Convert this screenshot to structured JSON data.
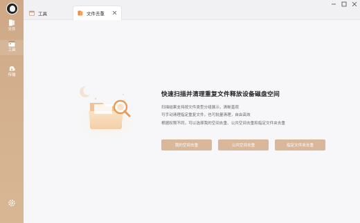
{
  "sidebar": {
    "items": [
      {
        "label": "文件",
        "icon": "file-icon"
      },
      {
        "label": "工具",
        "icon": "toolbox-icon"
      },
      {
        "label": "传输",
        "icon": "transfer-icon"
      }
    ],
    "settings_icon": "gear-icon"
  },
  "tabs": [
    {
      "label": "工具",
      "icon": "toolbox-tab-icon"
    },
    {
      "label": "文件去重",
      "icon": "dedupe-tab-icon"
    }
  ],
  "main": {
    "title": "快速扫描并清理重复文件释放设备磁盘空间",
    "description": [
      "扫描结果支持按文件类型分组展示，清晰直观",
      "可手动清理指定重复文件，也可批量清理，自由高效",
      "根据权限不同，可以选择我的空间去重、公共空间去重和指定文件夹去重"
    ],
    "buttons": {
      "my_space": "我的空间去重",
      "public_space": "公共空间去重",
      "folder": "指定文件夹去重"
    }
  },
  "colors": {
    "sidebar": "#cfa987",
    "accent_button": "#d8b79a",
    "tab_icon": "#f08a3a"
  }
}
